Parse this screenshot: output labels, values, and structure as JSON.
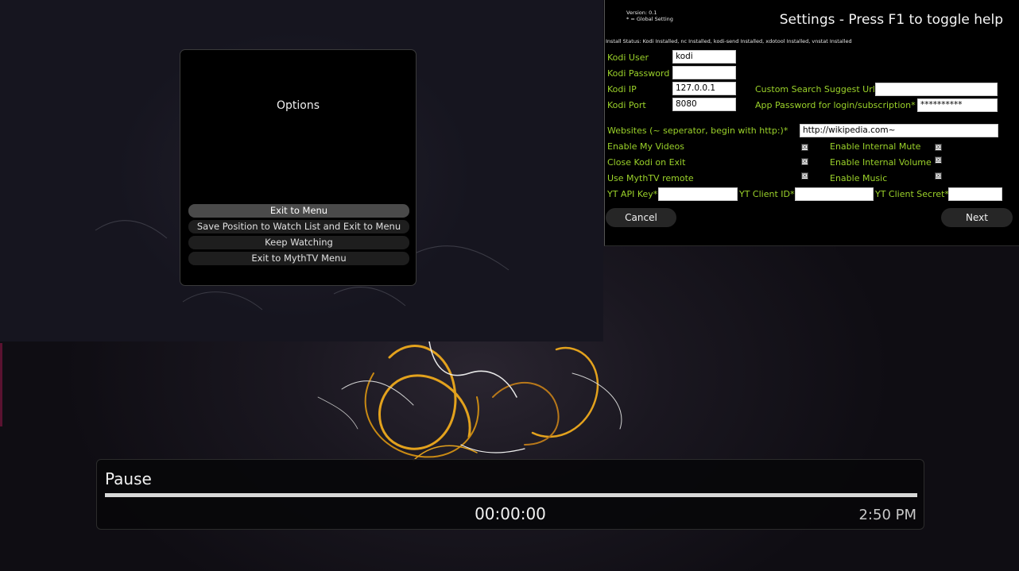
{
  "options_dialog": {
    "title": "Options",
    "items": [
      {
        "label": "Exit to Menu",
        "selected": true
      },
      {
        "label": "Save Position to Watch List and Exit to Menu",
        "selected": false
      },
      {
        "label": "Keep Watching",
        "selected": false
      },
      {
        "label": "Exit to MythTV Menu",
        "selected": false
      }
    ]
  },
  "settings": {
    "version": "Version: 0.1",
    "global_note": "* = Global Setting",
    "title": "Settings - Press F1 to toggle help",
    "install_status": "Install Status: Kodi Installed, nc Installed, kodi-send Installed, xdotool Installed, vnstat Installed",
    "fields": {
      "kodi_user": {
        "label": "Kodi User",
        "value": "kodi"
      },
      "kodi_password": {
        "label": "Kodi Password",
        "value": ""
      },
      "kodi_ip": {
        "label": "Kodi IP",
        "value": "127.0.0.1"
      },
      "kodi_port": {
        "label": "Kodi Port",
        "value": "8080"
      },
      "custom_search_url": {
        "label": "Custom Search Suggest Url*",
        "value": ""
      },
      "app_password": {
        "label": "App Password for login/subscription*",
        "value": "**********"
      },
      "websites": {
        "label": "Websites (~ seperator, begin with http:)*",
        "value": "http://wikipedia.com~"
      },
      "yt_api_key": {
        "label": "YT API Key*",
        "value": ""
      },
      "yt_client_id": {
        "label": "YT Client ID*",
        "value": ""
      },
      "yt_client_secret": {
        "label": "YT Client Secret*",
        "value": ""
      }
    },
    "checkboxes": {
      "enable_my_videos": {
        "label": "Enable My Videos",
        "checked": true
      },
      "close_kodi_on_exit": {
        "label": "Close Kodi on Exit",
        "checked": true
      },
      "use_mythtv_remote": {
        "label": "Use MythTV remote",
        "checked": true
      },
      "enable_internal_mute": {
        "label": "Enable Internal Mute",
        "checked": true
      },
      "enable_internal_volume": {
        "label": "Enable Internal Volume",
        "checked": true
      },
      "enable_music": {
        "label": "Enable Music",
        "checked": true
      }
    },
    "check_mark": "☒",
    "cancel_label": "Cancel",
    "next_label": "Next"
  },
  "osd": {
    "state": "Pause",
    "position": "00:00:00",
    "clock": "2:50 PM",
    "progress_percent": 100
  },
  "colors": {
    "label_green": "#9bd22a",
    "background": "#0e0c12",
    "accent_orange": "#e0a020"
  }
}
